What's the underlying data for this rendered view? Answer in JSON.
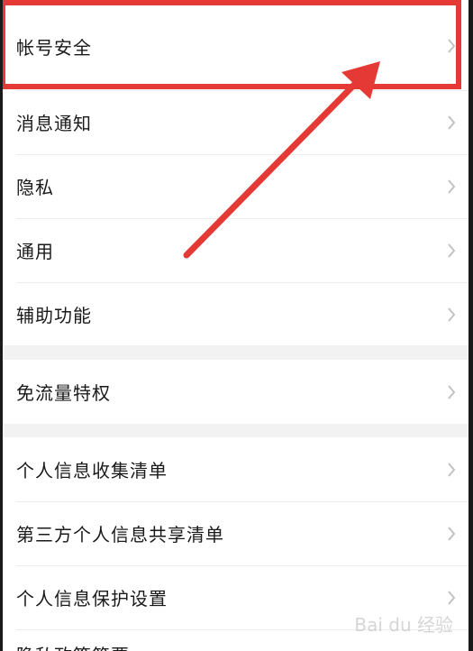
{
  "groups": [
    {
      "items": [
        {
          "label": "帐号安全"
        },
        {
          "label": "消息通知"
        },
        {
          "label": "隐私"
        },
        {
          "label": "通用"
        },
        {
          "label": "辅助功能"
        }
      ]
    },
    {
      "items": [
        {
          "label": "免流量特权"
        }
      ]
    },
    {
      "items": [
        {
          "label": "个人信息收集清单"
        },
        {
          "label": "第三方个人信息共享清单"
        },
        {
          "label": "个人信息保护设置"
        },
        {
          "label": "隐私政策简要"
        }
      ]
    }
  ],
  "icons": {
    "row_chevron": "chevron-right-icon"
  },
  "colors": {
    "annotation": "#e53935",
    "chevron": "#c2c2c2",
    "background": "#f2f2f2"
  },
  "watermark": {
    "text": "Bai du 经验"
  }
}
